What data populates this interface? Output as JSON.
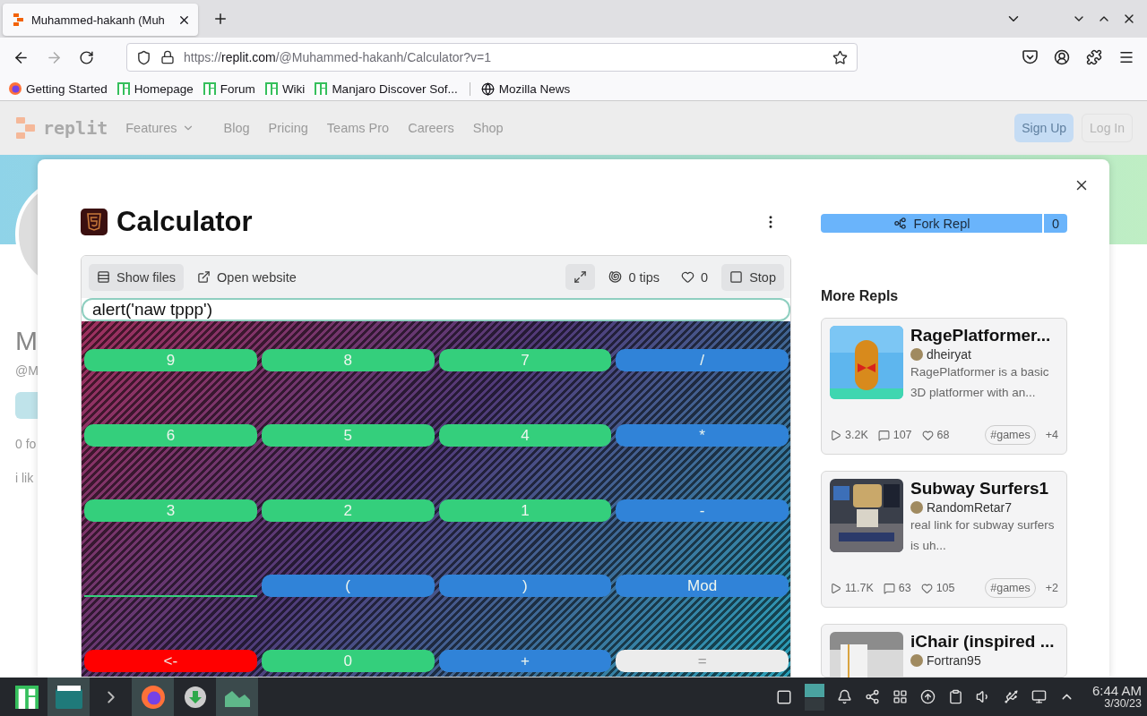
{
  "browser": {
    "tab": {
      "title": "Muhammed-hakanh (Muh",
      "selected": true
    },
    "url": {
      "scheme": "https://",
      "domain": "replit.com",
      "path": "/@Muhammed-hakanh/Calculator?v=1"
    },
    "bookmarks": [
      {
        "label": "Getting Started",
        "kind": "firefox",
        "separated": false
      },
      {
        "label": "Homepage",
        "kind": "manjaro",
        "separated": false
      },
      {
        "label": "Forum",
        "kind": "manjaro",
        "separated": false
      },
      {
        "label": "Wiki",
        "kind": "manjaro",
        "separated": false
      },
      {
        "label": "Manjaro Discover Sof...",
        "kind": "manjaro",
        "separated": false
      },
      {
        "label": "Mozilla News",
        "kind": "globe",
        "separated": true
      }
    ]
  },
  "header": {
    "logo": "replit",
    "nav": [
      {
        "label": "Features",
        "dropdown": true
      },
      {
        "label": "Blog",
        "dropdown": false
      },
      {
        "label": "Pricing",
        "dropdown": false
      },
      {
        "label": "Teams Pro",
        "dropdown": false
      },
      {
        "label": "Careers",
        "dropdown": false
      },
      {
        "label": "Shop",
        "dropdown": false
      }
    ],
    "sign_up": "Sign Up",
    "log_in": "Log In"
  },
  "background_profile": {
    "name": "M",
    "handle": "@M",
    "followers": "0 fo",
    "bio": "i lik"
  },
  "modal": {
    "title": "Calculator",
    "toolbar": {
      "show_files": {
        "label": "Show files",
        "selected": true
      },
      "open_website": "Open website",
      "tips": "0 tips",
      "likes": "0",
      "stop": "Stop"
    },
    "calculator": {
      "display": "alert('naw tppp')",
      "keys": [
        {
          "kind": "key",
          "label": "9",
          "color": "#34cf7c"
        },
        {
          "kind": "key",
          "label": "8",
          "color": "#34cf7c"
        },
        {
          "kind": "key",
          "label": "7",
          "color": "#34cf7c"
        },
        {
          "kind": "key",
          "label": "/",
          "color": "#3083d8"
        },
        {
          "kind": "key",
          "label": "6",
          "color": "#34cf7c"
        },
        {
          "kind": "key",
          "label": "5",
          "color": "#34cf7c"
        },
        {
          "kind": "key",
          "label": "4",
          "color": "#34cf7c"
        },
        {
          "kind": "key",
          "label": "*",
          "color": "#3083d8"
        },
        {
          "kind": "key",
          "label": "3",
          "color": "#34cf7c"
        },
        {
          "kind": "key",
          "label": "2",
          "color": "#34cf7c"
        },
        {
          "kind": "key",
          "label": "1",
          "color": "#34cf7c"
        },
        {
          "kind": "key",
          "label": "-",
          "color": "#3083d8"
        },
        {
          "kind": "line",
          "color": "#34cf7c"
        },
        {
          "kind": "key",
          "label": "(",
          "color": "#3083d8"
        },
        {
          "kind": "key",
          "label": ")",
          "color": "#3083d8"
        },
        {
          "kind": "key",
          "label": "Mod",
          "color": "#3083d8"
        },
        {
          "kind": "key",
          "label": "<-",
          "color": "#ff0000"
        },
        {
          "kind": "key",
          "label": "0",
          "color": "#34cf7c"
        },
        {
          "kind": "key",
          "label": "+",
          "color": "#3083d8"
        },
        {
          "kind": "key",
          "label": "=",
          "color": "#ececec"
        }
      ]
    },
    "fork": {
      "label": "Fork Repl",
      "count": "0"
    },
    "more_repls": {
      "title": "More Repls",
      "repls": [
        {
          "title": "RagePlatformer...",
          "author": "dheiryat",
          "description": "RagePlatformer is a basic 3D platformer with an...",
          "runs": "3.2K",
          "comments": "107",
          "likes": "68",
          "tag": "#games",
          "more_tags": "+4"
        },
        {
          "title": "Subway Surfers1",
          "author": "RandomRetar7",
          "description": "real link for subway surfers is uh...",
          "runs": "11.7K",
          "comments": "63",
          "likes": "105",
          "tag": "#games",
          "more_tags": "+2"
        },
        {
          "title": "iChair (inspired ...",
          "author": "Fortran95"
        }
      ]
    }
  },
  "taskbar": {
    "apps": [
      {
        "kind": "manjaro",
        "active": false
      },
      {
        "kind": "files",
        "active": true
      },
      {
        "kind": "terminal",
        "active": false
      },
      {
        "kind": "firefox",
        "active": true
      },
      {
        "kind": "download",
        "active": false
      },
      {
        "kind": "monitor",
        "active": true
      }
    ],
    "time": "6:44 AM",
    "date": "3/30/23"
  }
}
